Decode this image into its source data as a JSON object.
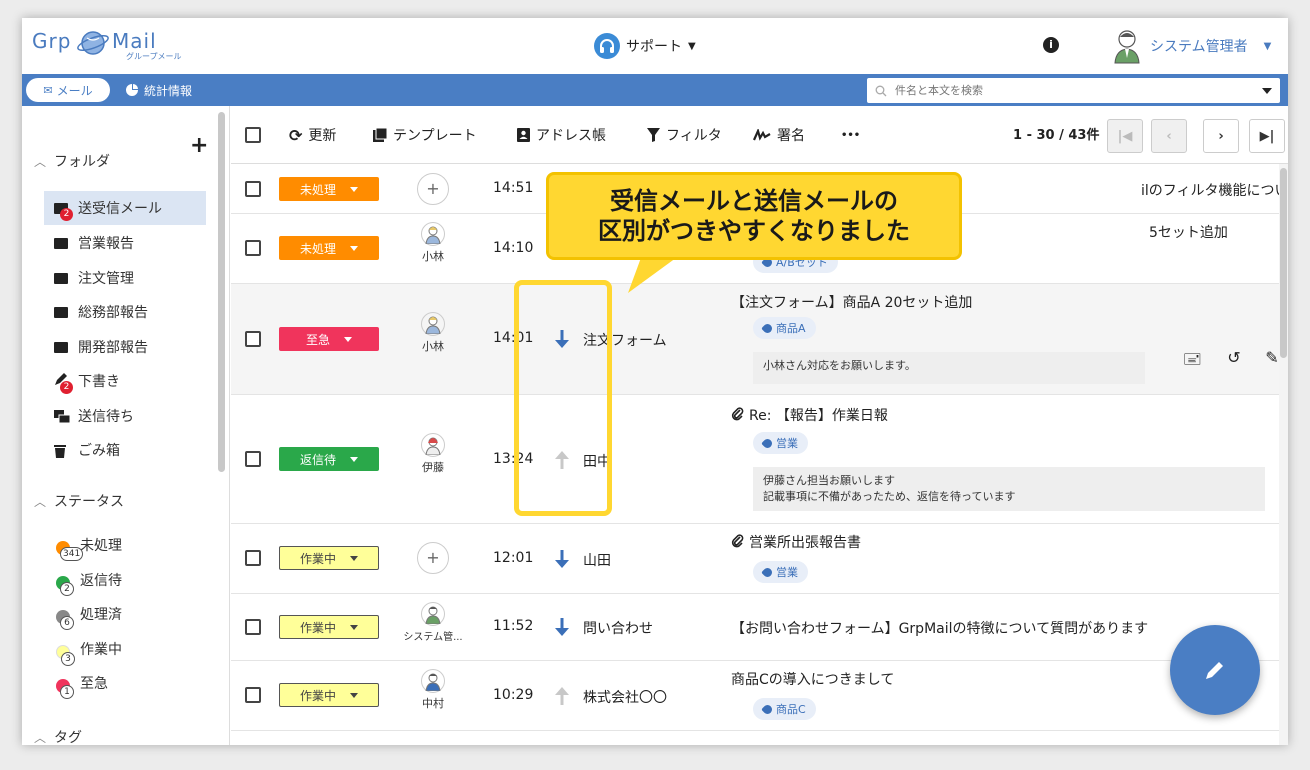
{
  "header": {
    "logo_text_left": "Grp",
    "logo_text_right": "Mail",
    "logo_sub": "グループメール",
    "support_label": "サポート",
    "user_name": "システム管理者"
  },
  "nav": {
    "tab_mail": "メール",
    "tab_stats": "統計情報",
    "search_placeholder": "件名と本文を検索"
  },
  "sidebar": {
    "folders_title": "フォルダ",
    "folders": [
      {
        "label": "送受信メール",
        "badge": "2"
      },
      {
        "label": "営業報告"
      },
      {
        "label": "注文管理"
      },
      {
        "label": "総務部報告"
      },
      {
        "label": "開発部報告"
      },
      {
        "label": "下書き",
        "badge": "2"
      },
      {
        "label": "送信待ち"
      },
      {
        "label": "ごみ箱"
      }
    ],
    "status_title": "ステータス",
    "statuses": [
      {
        "label": "未処理",
        "count": "341",
        "color": "#ff8c00"
      },
      {
        "label": "返信待",
        "count": "2",
        "color": "#2aa84a"
      },
      {
        "label": "処理済",
        "count": "6",
        "color": "#888888"
      },
      {
        "label": "作業中",
        "count": "3",
        "color": "#ffff99"
      },
      {
        "label": "至急",
        "count": "1",
        "color": "#f0345c"
      }
    ],
    "tags_title": "タグ"
  },
  "toolbar": {
    "refresh": "更新",
    "template": "テンプレート",
    "address_book": "アドレス帳",
    "filter": "フィルタ",
    "signature": "署名",
    "more": "•••",
    "pager": "1 - 30 / 43件"
  },
  "rows": [
    {
      "status": "未処理",
      "time": "14:51",
      "from": "",
      "subject": "ilのフィルタ機能について",
      "assignee": ""
    },
    {
      "status": "未処理",
      "time": "14:10",
      "from": "",
      "subject": "5セット追加",
      "tag": "A/Bセット",
      "assignee": "小林"
    },
    {
      "status": "至急",
      "time": "14:01",
      "from": "注文フォーム",
      "subject": "【注文フォーム】商品A 20セット追加",
      "tag": "商品A",
      "memo": "小林さん対応をお願いします。",
      "assignee": "小林"
    },
    {
      "status": "返信待",
      "time": "13:24",
      "from": "田中",
      "subject": "Re: 【報告】作業日報",
      "tag": "営業",
      "memo1": "伊藤さん担当お願いします",
      "memo2": "記載事項に不備があったため、返信を待っています",
      "assignee": "伊藤"
    },
    {
      "status": "作業中",
      "time": "12:01",
      "from": "山田",
      "subject": "営業所出張報告書",
      "tag": "営業",
      "assignee": ""
    },
    {
      "status": "作業中",
      "time": "11:52",
      "from": "問い合わせ",
      "subject": "【お問い合わせフォーム】GrpMailの特徴について質問があります",
      "assignee": "システム管..."
    },
    {
      "status": "作業中",
      "time": "10:29",
      "from": "株式会社〇〇",
      "subject": "商品Cの導入につきまして",
      "tag": "商品C",
      "assignee": "中村"
    }
  ],
  "callout": {
    "line1": "受信メールと送信メールの",
    "line2": "区別がつきやすくなりました"
  },
  "colors": {
    "accent": "#4a7ec4",
    "callout": "#ffd731",
    "received_arrow": "#3b6fb8",
    "sent_arrow": "#c8c8c8"
  }
}
